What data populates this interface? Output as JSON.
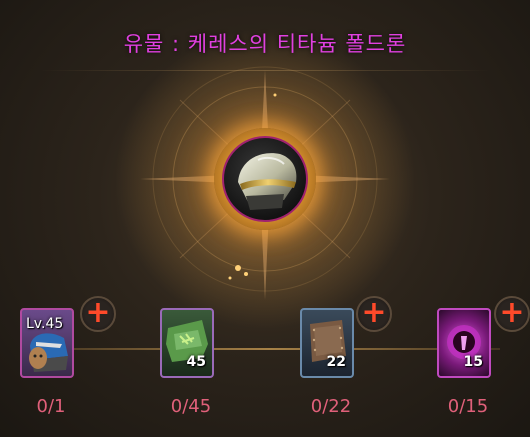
{
  "title": "유물 : 케레스의 티타늄 폴드론",
  "colors": {
    "title": "#e040e0",
    "progress": "#e0607a",
    "plus": "#ff4a2a"
  },
  "relic": {
    "icon": "shoulder-armor-icon"
  },
  "materials": [
    {
      "icon": "blue-armor-icon",
      "level": "Lv.45",
      "count": "",
      "progress": "0/1"
    },
    {
      "icon": "green-leaf-icon",
      "level": "",
      "count": "45",
      "progress": "0/45"
    },
    {
      "icon": "leather-scrap-icon",
      "level": "",
      "count": "22",
      "progress": "0/22"
    },
    {
      "icon": "purple-orb-icon",
      "level": "",
      "count": "15",
      "progress": "0/15"
    }
  ],
  "plus_symbol": "+"
}
